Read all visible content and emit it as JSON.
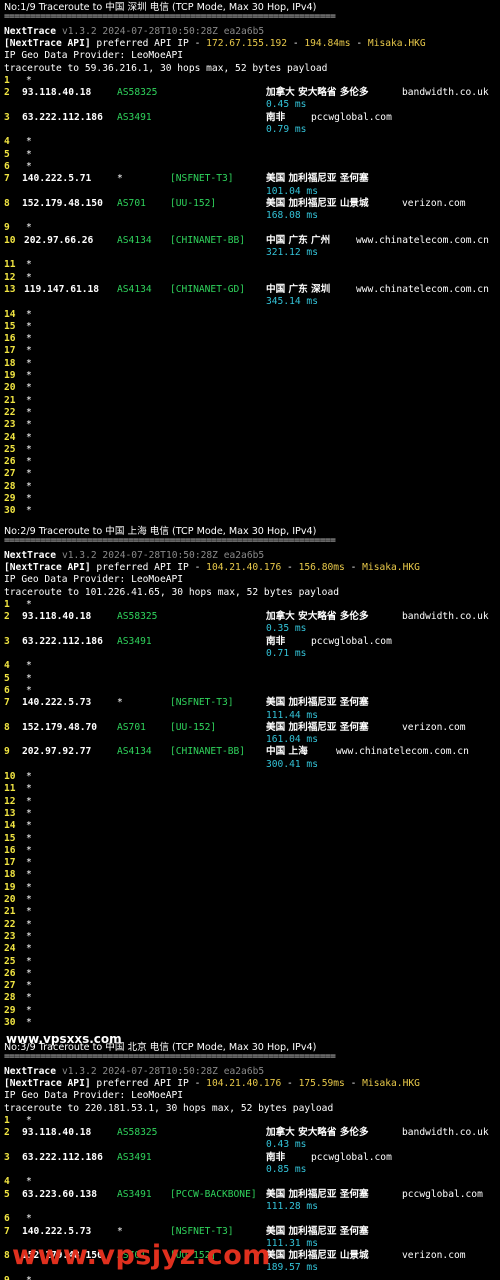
{
  "traces": [
    {
      "title": "No:1/9 Traceroute to 中国 深圳 电信 (TCP Mode, Max 30 Hop, IPv4)",
      "separator": "================================================================",
      "header": {
        "name": "NextTrace",
        "version": "v1.3.2 2024-07-28T10:50:28Z ea2a6b5"
      },
      "api": {
        "label": "[NextTrace API]",
        "text": " preferred API IP - ",
        "ip": "172.67.155.192",
        "dash1": " - ",
        "latency": "194.84ms",
        "dash2": " - ",
        "site": "Misaka.HKG"
      },
      "provider": "IP Geo Data Provider: LeoMoeAPI",
      "target": "traceroute to 59.36.216.1, 30 hops max, 52 bytes payload",
      "hops": [
        {
          "n": "1",
          "star": "*"
        },
        {
          "n": "2",
          "ip": "93.118.40.18",
          "asn": "AS58325",
          "geo": "加拿大 安大略省 多伦多",
          "domain": "bandwidth.co.uk",
          "rtt": "0.45 ms"
        },
        {
          "n": "3",
          "ip": "63.222.112.186",
          "asn": "AS3491",
          "geo": "南非",
          "domain": "pccwglobal.com",
          "rtt": "0.79 ms"
        },
        {
          "n": "4",
          "star": "*"
        },
        {
          "n": "5",
          "star": "*"
        },
        {
          "n": "6",
          "star": "*"
        },
        {
          "n": "7",
          "ip": "140.222.5.71",
          "asn": "*",
          "tag": "[NSFNET-T3]",
          "geo": "美国 加利福尼亚 圣何塞",
          "rtt": "101.04 ms"
        },
        {
          "n": "8",
          "ip": "152.179.48.150",
          "asn": "AS701",
          "tag": "[UU-152]",
          "geo": "美国 加利福尼亚 山景城",
          "domain": "verizon.com",
          "rtt": "168.08 ms"
        },
        {
          "n": "9",
          "star": "*"
        },
        {
          "n": "10",
          "ip": "202.97.66.26",
          "asn": "AS4134",
          "tag": "[CHINANET-BB]",
          "geo": "中国 广东 广州",
          "domain": "www.chinatelecom.com.cn",
          "rtt": "321.12 ms"
        },
        {
          "n": "11",
          "star": "*"
        },
        {
          "n": "12",
          "star": "*"
        },
        {
          "n": "13",
          "ip": "119.147.61.18",
          "asn": "AS4134",
          "tag": "[CHINANET-GD]",
          "geo": "中国 广东 深圳",
          "domain": "www.chinatelecom.com.cn",
          "rtt": "345.14 ms"
        },
        {
          "n": "14",
          "star": "*"
        },
        {
          "n": "15",
          "star": "*"
        },
        {
          "n": "16",
          "star": "*"
        },
        {
          "n": "17",
          "star": "*"
        },
        {
          "n": "18",
          "star": "*"
        },
        {
          "n": "19",
          "star": "*"
        },
        {
          "n": "20",
          "star": "*"
        },
        {
          "n": "21",
          "star": "*"
        },
        {
          "n": "22",
          "star": "*"
        },
        {
          "n": "23",
          "star": "*"
        },
        {
          "n": "24",
          "star": "*"
        },
        {
          "n": "25",
          "star": "*"
        },
        {
          "n": "26",
          "star": "*"
        },
        {
          "n": "27",
          "star": "*"
        },
        {
          "n": "28",
          "star": "*"
        },
        {
          "n": "29",
          "star": "*"
        },
        {
          "n": "30",
          "star": "*"
        }
      ]
    },
    {
      "title": "No:2/9 Traceroute to 中国 上海 电信 (TCP Mode, Max 30 Hop, IPv4)",
      "separator": "================================================================",
      "header": {
        "name": "NextTrace",
        "version": "v1.3.2 2024-07-28T10:50:28Z ea2a6b5"
      },
      "api": {
        "label": "[NextTrace API]",
        "text": " preferred API IP - ",
        "ip": "104.21.40.176",
        "dash1": " - ",
        "latency": "156.80ms",
        "dash2": " - ",
        "site": "Misaka.HKG"
      },
      "provider": "IP Geo Data Provider: LeoMoeAPI",
      "target": "traceroute to 101.226.41.65, 30 hops max, 52 bytes payload",
      "hops": [
        {
          "n": "1",
          "star": "*"
        },
        {
          "n": "2",
          "ip": "93.118.40.18",
          "asn": "AS58325",
          "geo": "加拿大 安大略省 多伦多",
          "domain": "bandwidth.co.uk",
          "rtt": "0.35 ms"
        },
        {
          "n": "3",
          "ip": "63.222.112.186",
          "asn": "AS3491",
          "geo": "南非",
          "domain": "pccwglobal.com",
          "rtt": "0.71 ms"
        },
        {
          "n": "4",
          "star": "*"
        },
        {
          "n": "5",
          "star": "*"
        },
        {
          "n": "6",
          "star": "*"
        },
        {
          "n": "7",
          "ip": "140.222.5.73",
          "asn": "*",
          "tag": "[NSFNET-T3]",
          "geo": "美国 加利福尼亚 圣何塞",
          "rtt": "111.44 ms"
        },
        {
          "n": "8",
          "ip": "152.179.48.70",
          "asn": "AS701",
          "tag": "[UU-152]",
          "geo": "美国 加利福尼亚 圣何塞",
          "domain": "verizon.com",
          "rtt": "161.04 ms"
        },
        {
          "n": "9",
          "ip": "202.97.92.77",
          "asn": "AS4134",
          "tag": "[CHINANET-BB]",
          "geo": "中国 上海",
          "domain": "www.chinatelecom.com.cn",
          "rtt": "300.41 ms"
        },
        {
          "n": "10",
          "star": "*"
        },
        {
          "n": "11",
          "star": "*"
        },
        {
          "n": "12",
          "star": "*"
        },
        {
          "n": "13",
          "star": "*"
        },
        {
          "n": "14",
          "star": "*"
        },
        {
          "n": "15",
          "star": "*"
        },
        {
          "n": "16",
          "star": "*"
        },
        {
          "n": "17",
          "star": "*"
        },
        {
          "n": "18",
          "star": "*"
        },
        {
          "n": "19",
          "star": "*"
        },
        {
          "n": "20",
          "star": "*"
        },
        {
          "n": "21",
          "star": "*"
        },
        {
          "n": "22",
          "star": "*"
        },
        {
          "n": "23",
          "star": "*"
        },
        {
          "n": "24",
          "star": "*"
        },
        {
          "n": "25",
          "star": "*"
        },
        {
          "n": "26",
          "star": "*"
        },
        {
          "n": "27",
          "star": "*"
        },
        {
          "n": "28",
          "star": "*"
        },
        {
          "n": "29",
          "star": "*"
        },
        {
          "n": "30",
          "star": "*"
        }
      ]
    },
    {
      "title": "No:3/9 Traceroute to 中国 北京 电信 (TCP Mode, Max 30 Hop, IPv4)",
      "separator": "================================================================",
      "header": {
        "name": "NextTrace",
        "version": "v1.3.2 2024-07-28T10:50:28Z ea2a6b5"
      },
      "api": {
        "label": "[NextTrace API]",
        "text": " preferred API IP - ",
        "ip": "104.21.40.176",
        "dash1": " - ",
        "latency": "175.59ms",
        "dash2": " - ",
        "site": "Misaka.HKG"
      },
      "provider": "IP Geo Data Provider: LeoMoeAPI",
      "target": "traceroute to 220.181.53.1, 30 hops max, 52 bytes payload",
      "hops": [
        {
          "n": "1",
          "star": "*"
        },
        {
          "n": "2",
          "ip": "93.118.40.18",
          "asn": "AS58325",
          "geo": "加拿大 安大略省 多伦多",
          "domain": "bandwidth.co.uk",
          "rtt": "0.43 ms"
        },
        {
          "n": "3",
          "ip": "63.222.112.186",
          "asn": "AS3491",
          "geo": "南非",
          "domain": "pccwglobal.com",
          "rtt": "0.85 ms"
        },
        {
          "n": "4",
          "star": "*"
        },
        {
          "n": "5",
          "ip": "63.223.60.138",
          "asn": "AS3491",
          "tag": "[PCCW-BACKBONE]",
          "geo": "美国 加利福尼亚 圣何塞",
          "domain": "pccwglobal.com",
          "rtt": "111.28 ms"
        },
        {
          "n": "6",
          "star": "*"
        },
        {
          "n": "7",
          "ip": "140.222.5.73",
          "asn": "*",
          "tag": "[NSFNET-T3]",
          "geo": "美国 加利福尼亚 圣何塞",
          "rtt": "111.31 ms"
        },
        {
          "n": "8",
          "ip": "152.179.48.150",
          "asn": "AS701",
          "tag": "[UU-152]",
          "geo": "美国 加利福尼亚 山景城",
          "domain": "verizon.com",
          "rtt": "189.57 ms"
        },
        {
          "n": "9",
          "star": "*"
        }
      ]
    }
  ],
  "watermarks": {
    "top": "www.vpsxxs.com",
    "bottom": "www.vpsjyz.com"
  }
}
